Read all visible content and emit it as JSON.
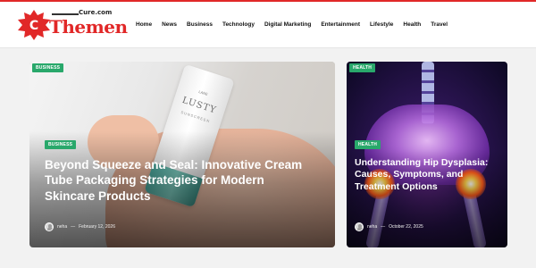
{
  "site": {
    "logo_top": "Cure.com",
    "logo_word": "Themen",
    "brand_color": "#e12828"
  },
  "nav": {
    "items": [
      {
        "label": "Home"
      },
      {
        "label": "News"
      },
      {
        "label": "Business"
      },
      {
        "label": "Technology"
      },
      {
        "label": "Digital Marketing"
      },
      {
        "label": "Entertainment"
      },
      {
        "label": "Lifestyle"
      },
      {
        "label": "Health"
      },
      {
        "label": "Travel"
      }
    ]
  },
  "main_post": {
    "category_top": "BUSINESS",
    "category": "BUSINESS",
    "title": "Beyond Squeeze and Seal: Innovative Cream Tube Packaging Strategies for Modern Skincare Products",
    "author": "neha",
    "separator": "—",
    "date": "February 12, 2026",
    "image": {
      "product_brand": "LUSTY",
      "product_small": "LANE",
      "product_sub": "SUNSCREEN"
    },
    "badge_color": "#29a86b"
  },
  "side_post": {
    "category_top": "HEALTH",
    "category": "HEALTH",
    "title": "Understanding Hip Dysplasia: Causes, Symptoms, and Treatment Options",
    "author": "neha",
    "separator": "—",
    "date": "October 22, 2025",
    "badge_color": "#29a86b"
  }
}
